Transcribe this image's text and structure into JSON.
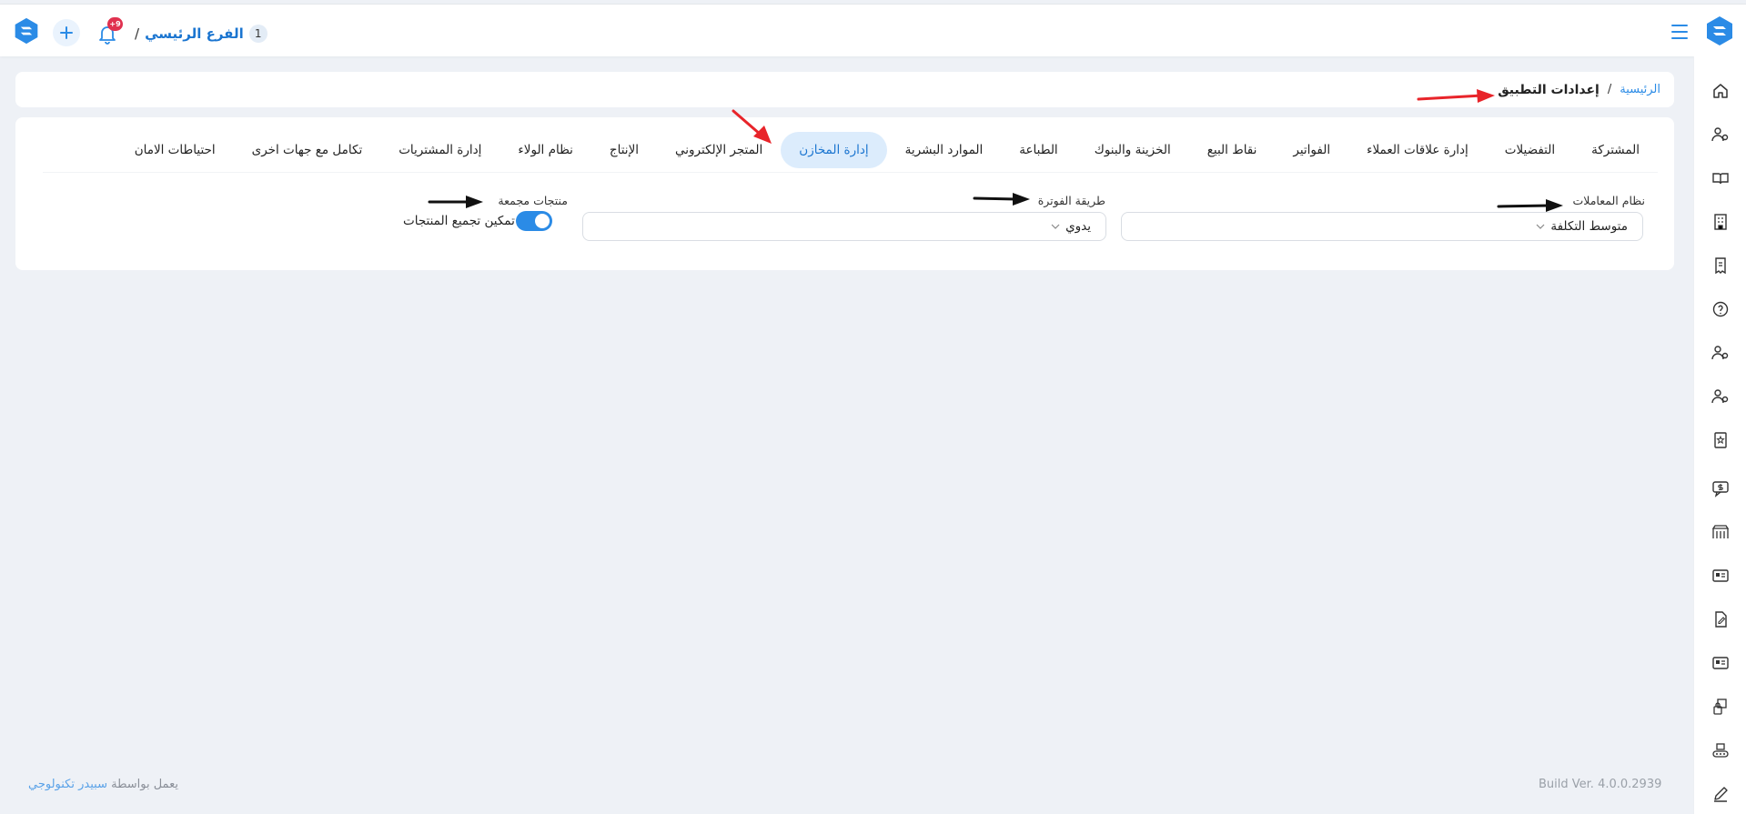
{
  "header": {
    "branch_number": "1",
    "branch_name": "الفرع الرئيسي",
    "branch_separator": "/",
    "notification_count": "+9"
  },
  "breadcrumb": {
    "home": "الرئيسية",
    "separator": "/",
    "current": "إعدادات التطبيق"
  },
  "tabs": [
    {
      "label": "المشتركة",
      "active": false
    },
    {
      "label": "التفضيلات",
      "active": false
    },
    {
      "label": "إدارة علاقات العملاء",
      "active": false
    },
    {
      "label": "الفواتير",
      "active": false
    },
    {
      "label": "نقاط البيع",
      "active": false
    },
    {
      "label": "الخزينة والبنوك",
      "active": false
    },
    {
      "label": "الطباعة",
      "active": false
    },
    {
      "label": "الموارد البشرية",
      "active": false
    },
    {
      "label": "إدارة المخازن",
      "active": true
    },
    {
      "label": "المتجر الإلكتروني",
      "active": false
    },
    {
      "label": "الإنتاج",
      "active": false
    },
    {
      "label": "نظام الولاء",
      "active": false
    },
    {
      "label": "إدارة المشتريات",
      "active": false
    },
    {
      "label": "تكامل مع جهات اخرى",
      "active": false
    },
    {
      "label": "احتياطات الامان",
      "active": false
    }
  ],
  "form": {
    "transactions_label": "نظام المعاملات",
    "transactions_value": "متوسط التكلفة",
    "invoicing_label": "طريقة الفوترة",
    "invoicing_value": "يدوي",
    "grouped_label": "منتجات مجمعة",
    "grouped_toggle_label": "تمكين تجميع المنتجات",
    "grouped_toggle_on": true
  },
  "footer": {
    "powered_prefix": "يعمل بواسطة",
    "powered_brand": "سبيدر تكنولوجي",
    "build": "Build Ver. 4.0.0.2939"
  },
  "colors": {
    "accent": "#2b8be6",
    "badge": "#e0314f",
    "annotation_red": "#e8242a",
    "annotation_black": "#111111"
  },
  "sidebar_icons": [
    "home-icon",
    "users-gear-icon",
    "book-icon",
    "building-icon",
    "receipt-icon",
    "help-icon",
    "users-gear-icon",
    "users-gear-icon",
    "contact-book-icon",
    "chat-money-icon",
    "shelf-icon",
    "id-card-icon",
    "document-edit-icon",
    "id-card-icon",
    "lock-box-icon",
    "conveyor-icon",
    "pen-icon"
  ]
}
